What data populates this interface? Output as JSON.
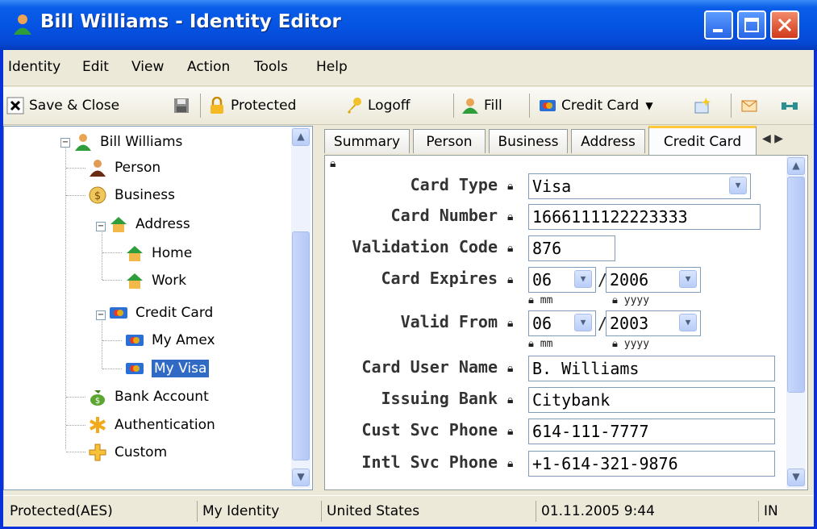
{
  "window": {
    "title": "Bill Williams - Identity Editor"
  },
  "menu": [
    "Identity",
    "Edit",
    "View",
    "Action",
    "Tools",
    "Help"
  ],
  "toolbar": {
    "save_close": "Save & Close",
    "protected": "Protected",
    "logoff": "Logoff",
    "fill": "Fill",
    "credit_card": "Credit Card"
  },
  "tree": {
    "root": "Bill Williams",
    "person": "Person",
    "business": "Business",
    "address": "Address",
    "home": "Home",
    "work": "Work",
    "credit_card": "Credit Card",
    "my_amex": "My Amex",
    "my_visa": "My Visa",
    "bank_account": "Bank Account",
    "authentication": "Authentication",
    "custom": "Custom"
  },
  "tabs": [
    "Summary",
    "Person",
    "Business",
    "Address",
    "Credit Card"
  ],
  "form": {
    "card_type_label": "Card Type",
    "card_type_value": "Visa",
    "card_number_label": "Card Number",
    "card_number_value": "1666111122223333",
    "validation_code_label": "Validation Code",
    "validation_code_value": "876",
    "card_expires_label": "Card Expires",
    "card_expires_month": "06",
    "card_expires_year": "2006",
    "valid_from_label": "Valid From",
    "valid_from_month": "06",
    "valid_from_year": "2003",
    "mm": "mm",
    "yyyy": "yyyy",
    "card_user_name_label": "Card User Name",
    "card_user_name_value": "B. Williams",
    "issuing_bank_label": "Issuing Bank",
    "issuing_bank_value": "Citybank",
    "cust_svc_phone_label": "Cust Svc Phone",
    "cust_svc_phone_value": "614-111-7777",
    "intl_svc_phone_label": "Intl Svc Phone",
    "intl_svc_phone_value": "+1-614-321-9876",
    "slash": "/"
  },
  "status": {
    "encryption": "Protected(AES)",
    "identity": "My Identity",
    "country": "United States",
    "datetime": "01.11.2005 9:44",
    "mode": "IN"
  },
  "colors": {
    "title_bar": "#0554e3",
    "selection": "#316ac5",
    "tab_accent": "#ffc83c"
  }
}
